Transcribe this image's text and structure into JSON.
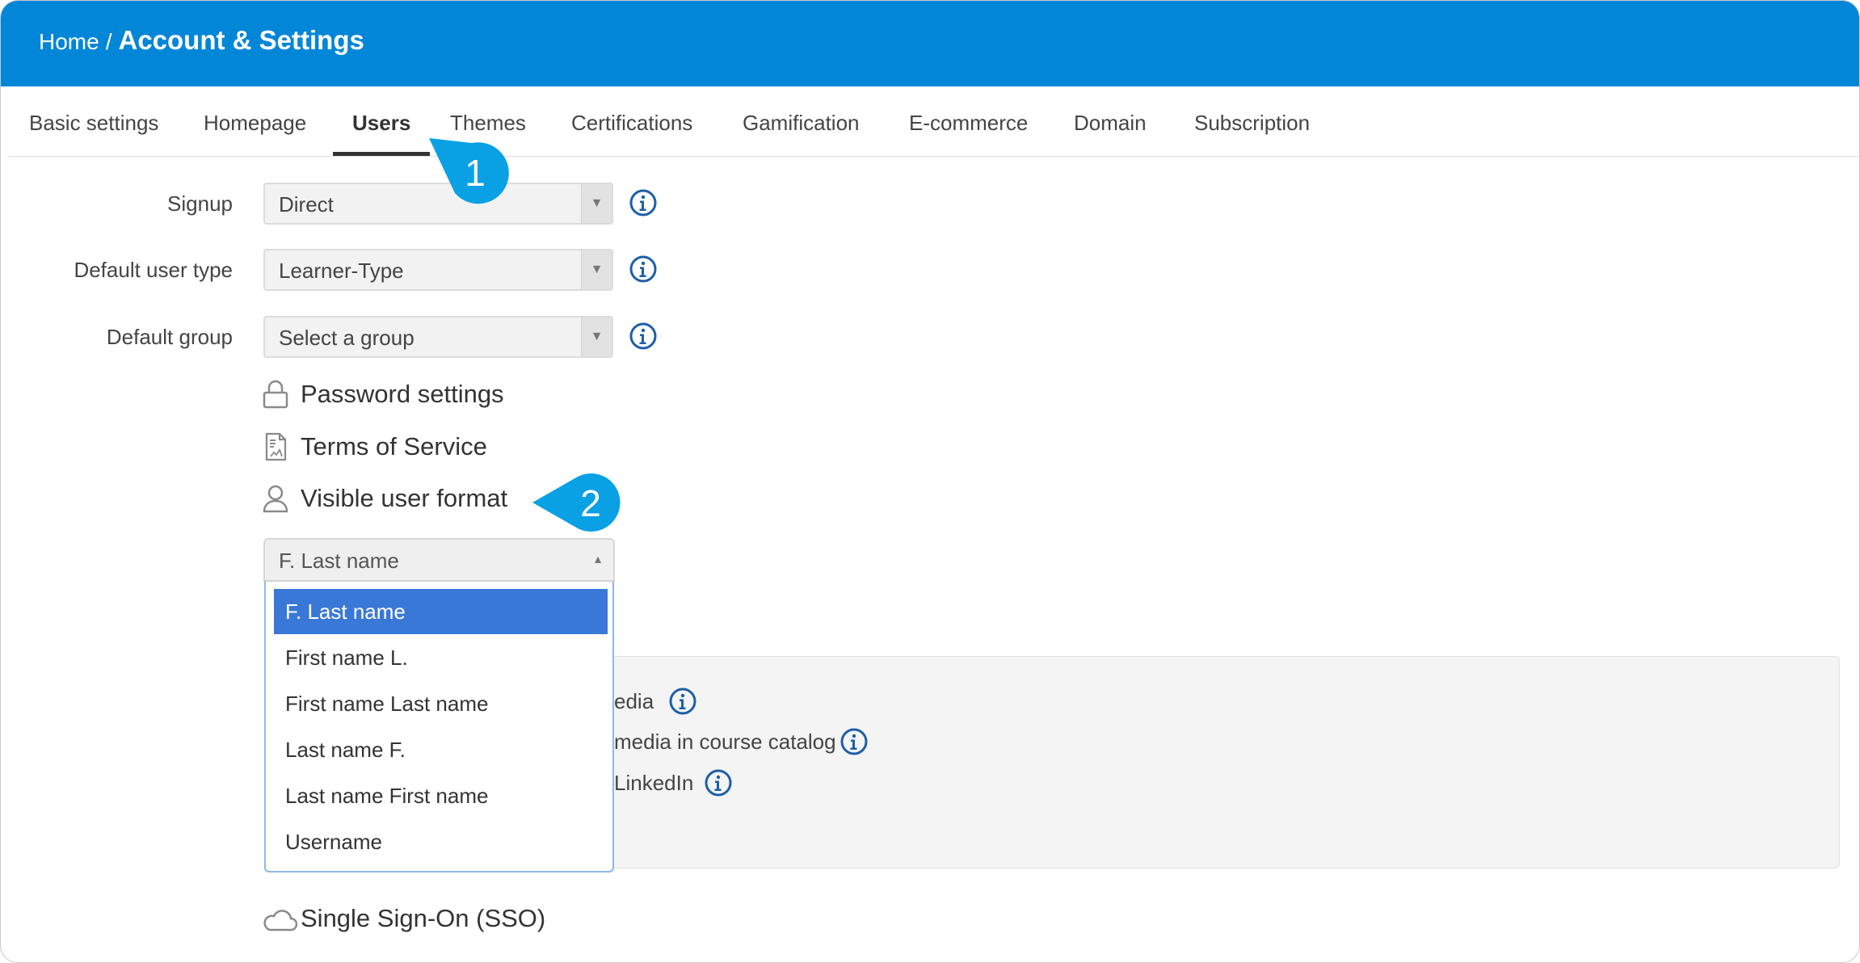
{
  "header": {
    "breadcrumb_home": "Home",
    "breadcrumb_sep": "/",
    "breadcrumb_current": "Account & Settings",
    "color": "#0286d8"
  },
  "tabs": [
    {
      "label": "Basic settings",
      "active": false
    },
    {
      "label": "Homepage",
      "active": false
    },
    {
      "label": "Users",
      "active": true
    },
    {
      "label": "Themes",
      "active": false
    },
    {
      "label": "Certifications",
      "active": false
    },
    {
      "label": "Gamification",
      "active": false
    },
    {
      "label": "E-commerce",
      "active": false
    },
    {
      "label": "Domain",
      "active": false
    },
    {
      "label": "Subscription",
      "active": false
    }
  ],
  "form": {
    "signup": {
      "label": "Signup",
      "value": "Direct"
    },
    "default_user_type": {
      "label": "Default user type",
      "value": "Learner-Type"
    },
    "default_group": {
      "label": "Default group",
      "value": "Select a group"
    }
  },
  "sections": {
    "password": "Password settings",
    "terms": "Terms of Service",
    "visible_user_format": "Visible user format",
    "sso": "Single Sign-On (SSO)"
  },
  "visible_user_format_dropdown": {
    "selected": "F. Last name",
    "options": [
      "F. Last name",
      "First name L.",
      "First name Last name",
      "Last name F.",
      "Last name First name",
      "Username"
    ],
    "highlight_color": "#3a78d8"
  },
  "panel_partial_text": [
    "edia",
    "media in course catalog",
    "LinkedIn"
  ],
  "callouts": [
    "1",
    "2"
  ],
  "callout_color": "#0aa0e4",
  "icons": {
    "info": "info-circle-icon",
    "password": "lock-icon",
    "terms": "document-icon",
    "visible_user_format": "user-icon",
    "sso": "cloud-icon",
    "select_caret": "caret-down-icon",
    "dropdown_caret": "caret-up-icon"
  }
}
